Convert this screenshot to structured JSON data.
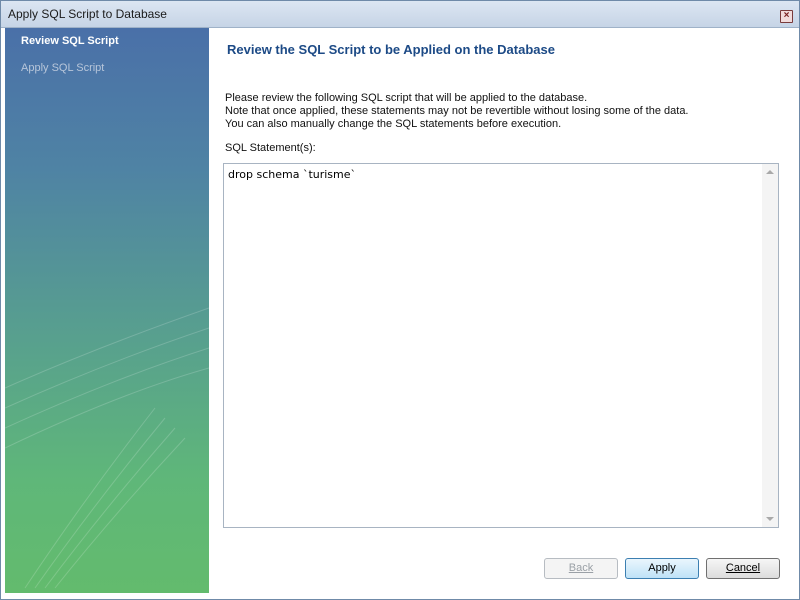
{
  "window": {
    "title": "Apply SQL Script to Database"
  },
  "sidebar": {
    "items": [
      {
        "label": "Review SQL Script",
        "active": true
      },
      {
        "label": "Apply SQL Script",
        "active": false
      }
    ]
  },
  "content": {
    "heading": "Review the SQL Script to be Applied on the Database",
    "description_lines": [
      "Please review the following SQL script that will be applied to the database.",
      "Note that once applied, these statements may not be revertible without losing some of the data.",
      "You can also manually change the SQL statements before execution."
    ],
    "sql_label": "SQL Statement(s):",
    "sql_text": "drop schema `turisme`"
  },
  "buttons": {
    "back": {
      "label": "Back",
      "enabled": false
    },
    "apply": {
      "label": "Apply",
      "enabled": true
    },
    "cancel": {
      "label": "Cancel",
      "enabled": true
    }
  },
  "icons": {
    "close": "close-icon",
    "scroll_up": "chevron-up-icon",
    "scroll_down": "chevron-down-icon"
  }
}
